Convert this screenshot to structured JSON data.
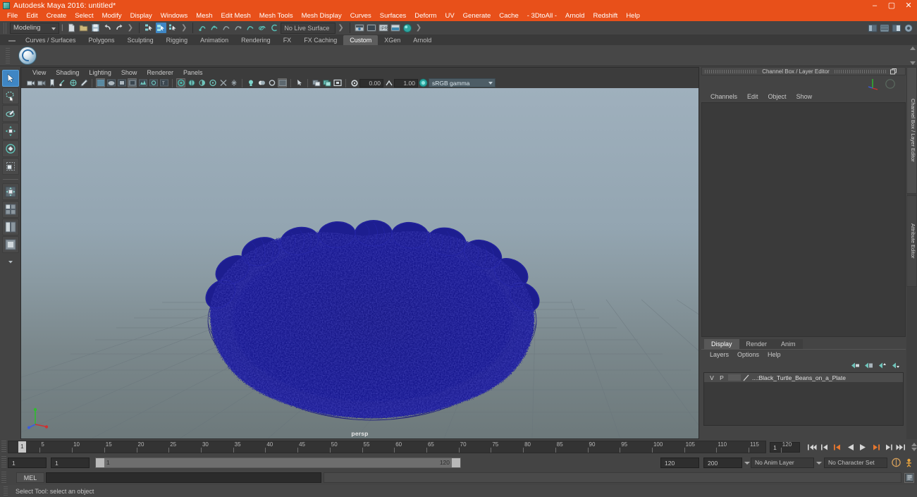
{
  "window": {
    "title": "Autodesk Maya 2016: untitled*",
    "minimize": "–",
    "maximize": "▢",
    "close": "✕"
  },
  "menubar": {
    "items": [
      "File",
      "Edit",
      "Create",
      "Select",
      "Modify",
      "Display",
      "Windows",
      "Mesh",
      "Edit Mesh",
      "Mesh Tools",
      "Mesh Display",
      "Curves",
      "Surfaces",
      "Deform",
      "UV",
      "Generate",
      "Cache",
      "- 3DtoAll -",
      "Arnold",
      "Redshift",
      "Help"
    ]
  },
  "statusline": {
    "menu_set": "Modeling",
    "live_surface": "No Live Surface"
  },
  "shelf": {
    "tabs": [
      "Curves / Surfaces",
      "Polygons",
      "Sculpting",
      "Rigging",
      "Animation",
      "Rendering",
      "FX",
      "FX Caching",
      "Custom",
      "XGen",
      "Arnold"
    ],
    "selected_tab": "Custom"
  },
  "viewport": {
    "menus": [
      "View",
      "Shading",
      "Lighting",
      "Show",
      "Renderer",
      "Panels"
    ],
    "exposure_value": "0.00",
    "gamma_value": "1.00",
    "color_management": "sRGB gamma",
    "camera_label": "persp",
    "axis_x": "x",
    "axis_y": "y",
    "axis_z": "z"
  },
  "channelbox": {
    "panel_title": "Channel Box / Layer Editor",
    "undock_icon": "undock-icon",
    "close_icon": "close-icon",
    "menus": [
      "Channels",
      "Edit",
      "Object",
      "Show"
    ]
  },
  "layereditor": {
    "tabs": [
      "Display",
      "Render",
      "Anim"
    ],
    "selected_tab": "Display",
    "menus": [
      "Layers",
      "Options",
      "Help"
    ],
    "rows": [
      {
        "visibility": "V",
        "playback": "P",
        "name": "...:Black_Turtle_Beans_on_a_Plate"
      }
    ]
  },
  "dock_tabs": [
    "Channel Box / Layer Editor",
    "Attribute Editor"
  ],
  "timeslider": {
    "ticks": [
      "5",
      "10",
      "15",
      "20",
      "25",
      "30",
      "35",
      "40",
      "45",
      "50",
      "55",
      "60",
      "65",
      "70",
      "75",
      "80",
      "85",
      "90",
      "95",
      "100",
      "105",
      "110",
      "115",
      "120"
    ],
    "current_frame": "1",
    "current_frame_field": "1",
    "playback_buttons": [
      "go-to-start",
      "step-back-key",
      "step-back-frame",
      "play-backwards",
      "play-forwards",
      "step-forward-frame",
      "step-forward-key",
      "go-to-end"
    ]
  },
  "rangeslider": {
    "anim_start": "1",
    "range_start": "1",
    "range_bar_start_label": "1",
    "range_bar_end_label": "120",
    "range_end": "120",
    "anim_end": "200",
    "anim_layer": "No Anim Layer",
    "character_set": "No Character Set"
  },
  "commandline": {
    "language": "MEL",
    "input_value": "",
    "script_editor_icon": "script-editor-icon"
  },
  "helpline": {
    "message": "Select Tool: select an object"
  },
  "colors": {
    "title_bar": "#e8501a",
    "accent_blue": "#3f86c4",
    "wireframe": "#1a1a96",
    "panel_bg": "#444444"
  },
  "scene": {
    "object_name": "Black_Turtle_Beans_on_a_Plate",
    "display_mode": "wireframe"
  }
}
